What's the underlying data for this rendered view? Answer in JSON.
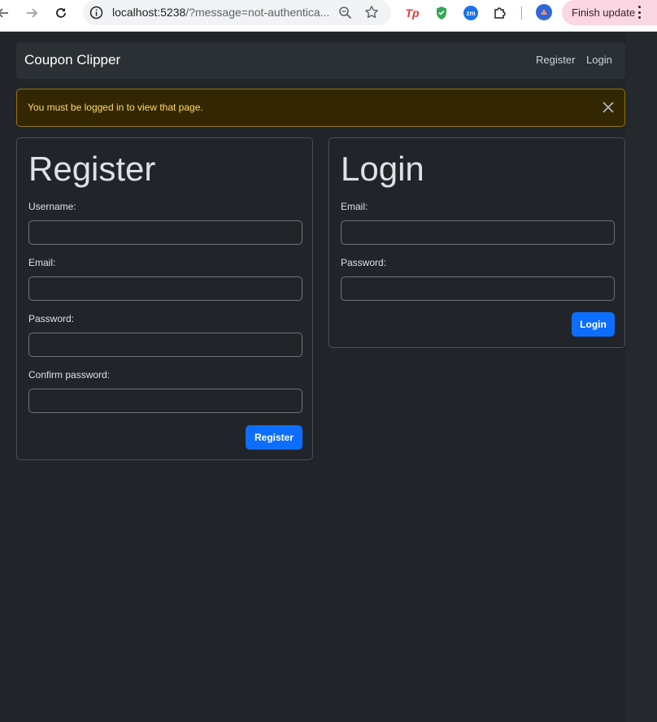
{
  "browser": {
    "url_host": "localhost:5238",
    "url_path": "/?message=not-authentica...",
    "extensions": [
      "Tp",
      "zm"
    ],
    "update_label": "Finish update"
  },
  "navbar": {
    "brand": "Coupon Clipper",
    "links": {
      "register": "Register",
      "login": "Login"
    }
  },
  "alert": {
    "message": "You must be logged in to view that page.",
    "color": "#ffda6a"
  },
  "register_form": {
    "title": "Register",
    "username_label": "Username:",
    "email_label": "Email:",
    "password_label": "Password:",
    "confirm_label": "Confirm password:",
    "submit_label": "Register"
  },
  "login_form": {
    "title": "Login",
    "email_label": "Email:",
    "password_label": "Password:",
    "submit_label": "Login"
  },
  "colors": {
    "background": "#212529",
    "primary": "#0d6efd",
    "alert_bg": "#332701"
  }
}
